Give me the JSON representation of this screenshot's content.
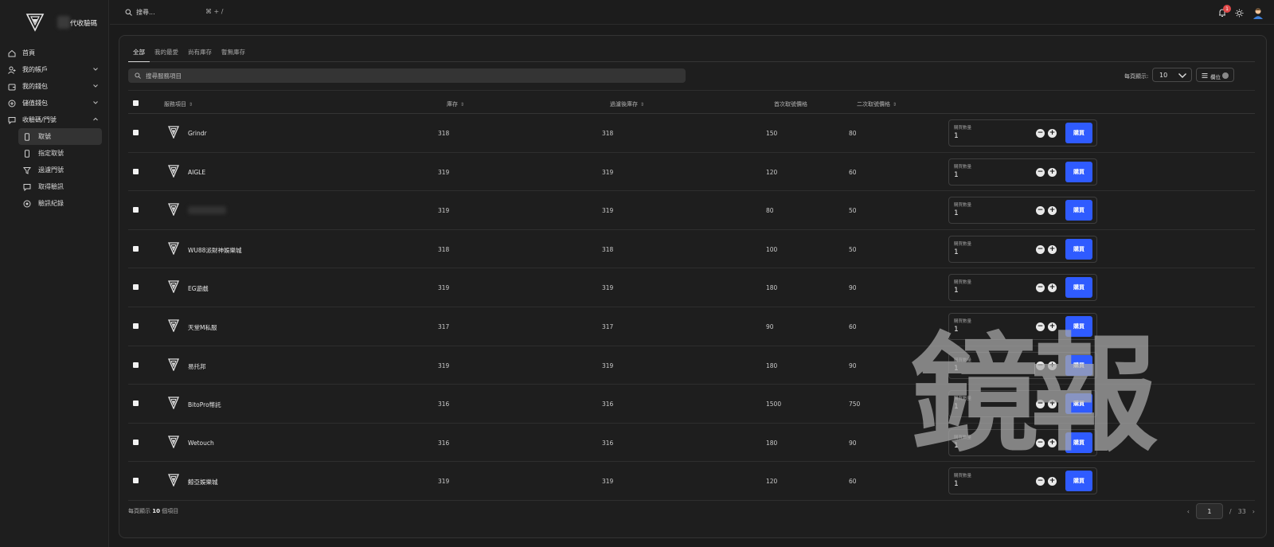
{
  "brand": {
    "name": "代收驗碼",
    "logo_icon": "shield-logo-icon"
  },
  "sidebar": {
    "items": [
      {
        "label": "首頁",
        "icon": "home-icon",
        "chevron": false
      },
      {
        "label": "我的帳戶",
        "icon": "user-icon",
        "chevron": true
      },
      {
        "label": "我的錢包",
        "icon": "wallet-icon",
        "chevron": true
      },
      {
        "label": "儲值錢包",
        "icon": "plus-circle-icon",
        "chevron": true
      },
      {
        "label": "收驗碼/門號",
        "icon": "message-icon",
        "chevron": true
      }
    ],
    "sub_items": [
      {
        "label": "取號",
        "icon": "phone-icon",
        "active": true
      },
      {
        "label": "指定取號",
        "icon": "phone-icon",
        "active": false
      },
      {
        "label": "過濾門號",
        "icon": "filter-icon",
        "active": false
      },
      {
        "label": "取得驗訊",
        "icon": "message-icon",
        "active": false
      },
      {
        "label": "驗訊紀錄",
        "icon": "record-icon",
        "active": false
      }
    ]
  },
  "topbar": {
    "search_placeholder": "搜尋...",
    "shortcut": "⌘ + /",
    "notification_count": "1"
  },
  "tabs": [
    {
      "label": "全部",
      "active": true
    },
    {
      "label": "我的最愛",
      "active": false
    },
    {
      "label": "尚有庫存",
      "active": false
    },
    {
      "label": "暫無庫存",
      "active": false
    }
  ],
  "filter": {
    "placeholder": "搜尋服務項目"
  },
  "perpage": {
    "label": "每頁顯示:",
    "value": "10"
  },
  "columns_button": {
    "label": "欄位"
  },
  "table": {
    "headers": {
      "service": "服務項目",
      "stock": "庫存",
      "filtered_stock": "過濾後庫存",
      "first_price": "首次取號價格",
      "second_price": "二次取號價格"
    },
    "buy_label": "購買數量",
    "buy_button": "購買",
    "rows": [
      {
        "name": "Grindr",
        "stock": "318",
        "filtered": "318",
        "first": "150",
        "second": "80",
        "qty": "1",
        "blurred": false
      },
      {
        "name": "AIGLE",
        "stock": "319",
        "filtered": "319",
        "first": "120",
        "second": "60",
        "qty": "1",
        "blurred": false
      },
      {
        "name": "",
        "stock": "319",
        "filtered": "319",
        "first": "80",
        "second": "50",
        "qty": "1",
        "blurred": true
      },
      {
        "name": "WU88派財神娛樂城",
        "stock": "318",
        "filtered": "318",
        "first": "100",
        "second": "50",
        "qty": "1",
        "blurred": false
      },
      {
        "name": "EG遊戲",
        "stock": "319",
        "filtered": "319",
        "first": "180",
        "second": "90",
        "qty": "1",
        "blurred": false
      },
      {
        "name": "天堂M私服",
        "stock": "317",
        "filtered": "317",
        "first": "90",
        "second": "60",
        "qty": "1",
        "blurred": false
      },
      {
        "name": "易托邦",
        "stock": "319",
        "filtered": "319",
        "first": "180",
        "second": "90",
        "qty": "1",
        "blurred": false
      },
      {
        "name": "BitoPro幣託",
        "stock": "316",
        "filtered": "316",
        "first": "1500",
        "second": "750",
        "qty": "1",
        "blurred": false
      },
      {
        "name": "Wetouch",
        "stock": "316",
        "filtered": "316",
        "first": "180",
        "second": "90",
        "qty": "1",
        "blurred": false
      },
      {
        "name": "鯨亞娛樂城",
        "stock": "319",
        "filtered": "319",
        "first": "120",
        "second": "60",
        "qty": "1",
        "blurred": false
      }
    ]
  },
  "footer": {
    "prefix": "每頁顯示",
    "count": "10",
    "suffix": "個項目",
    "current_page": "1",
    "separator": "/",
    "total_pages": "33"
  },
  "watermark": "鏡報"
}
